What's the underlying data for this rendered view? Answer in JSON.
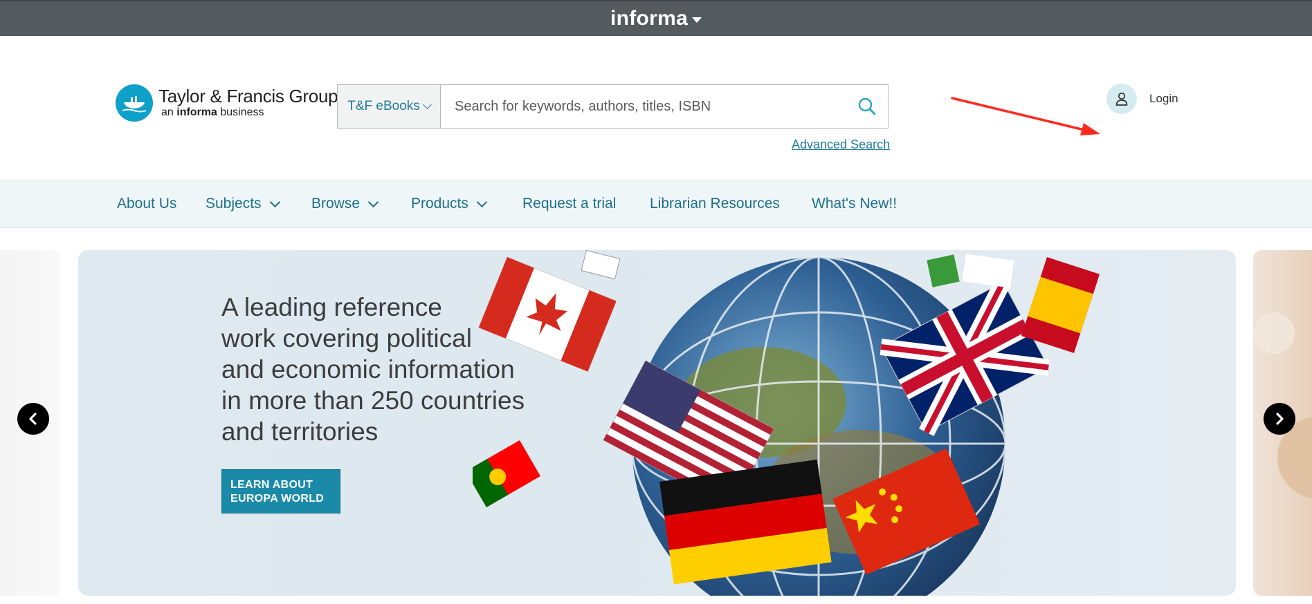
{
  "informa_bar": {
    "brand": "informa"
  },
  "header": {
    "logo": {
      "title": "Taylor & Francis Group",
      "sub_prefix": "an ",
      "sub_bold": "informa",
      "sub_suffix": " business"
    },
    "search": {
      "scope_label": "T&F eBooks",
      "placeholder": "Search for keywords, authors, titles, ISBN",
      "value": ""
    },
    "advanced_search": "Advanced Search",
    "login_label": "Login"
  },
  "nav": {
    "items": [
      {
        "label": "About Us",
        "dropdown": false
      },
      {
        "label": "Subjects",
        "dropdown": true
      },
      {
        "label": "Browse",
        "dropdown": true
      },
      {
        "label": "Products",
        "dropdown": true
      },
      {
        "label": "Request a trial",
        "dropdown": false
      },
      {
        "label": "Librarian Resources",
        "dropdown": false
      },
      {
        "label": "What's New!!",
        "dropdown": false
      }
    ]
  },
  "carousel": {
    "headline_lines": [
      "A leading reference",
      "work covering political",
      "and economic information",
      "in more than 250 countries",
      "and territories"
    ],
    "cta_lines": [
      "LEARN ABOUT",
      "EUROPA WORLD"
    ]
  },
  "colors": {
    "informa_bar": "#535b5e",
    "accent": "#1c6e8b",
    "nav_bg": "#eff6f7",
    "cta_bg": "#1a8aa8",
    "annotation_arrow": "#ff2a1f"
  }
}
